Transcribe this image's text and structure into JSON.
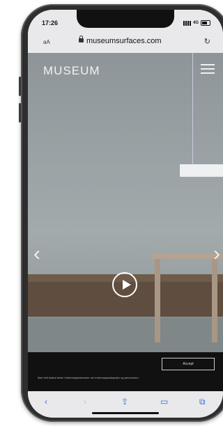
{
  "status_bar": {
    "time": "17:26",
    "network": "4G"
  },
  "url_bar": {
    "text_size_label": "aA",
    "url": "museumsurfaces.com"
  },
  "site": {
    "logo": "MUSEUM"
  },
  "cookie_banner": {
    "accept_label": "Accept",
    "text": "Ikke helt lesbar tekst i informasjonsbanner om informasjonskapsler og personvern."
  },
  "icons": {
    "lock": "lock-icon",
    "reload": "reload-icon",
    "menu": "hamburger-menu-icon",
    "play": "play-icon",
    "prev": "chevron-left-icon",
    "next": "chevron-right-icon",
    "back": "back-icon",
    "forward": "forward-icon",
    "share": "share-icon",
    "bookmarks": "bookmarks-icon",
    "tabs": "tabs-icon"
  }
}
